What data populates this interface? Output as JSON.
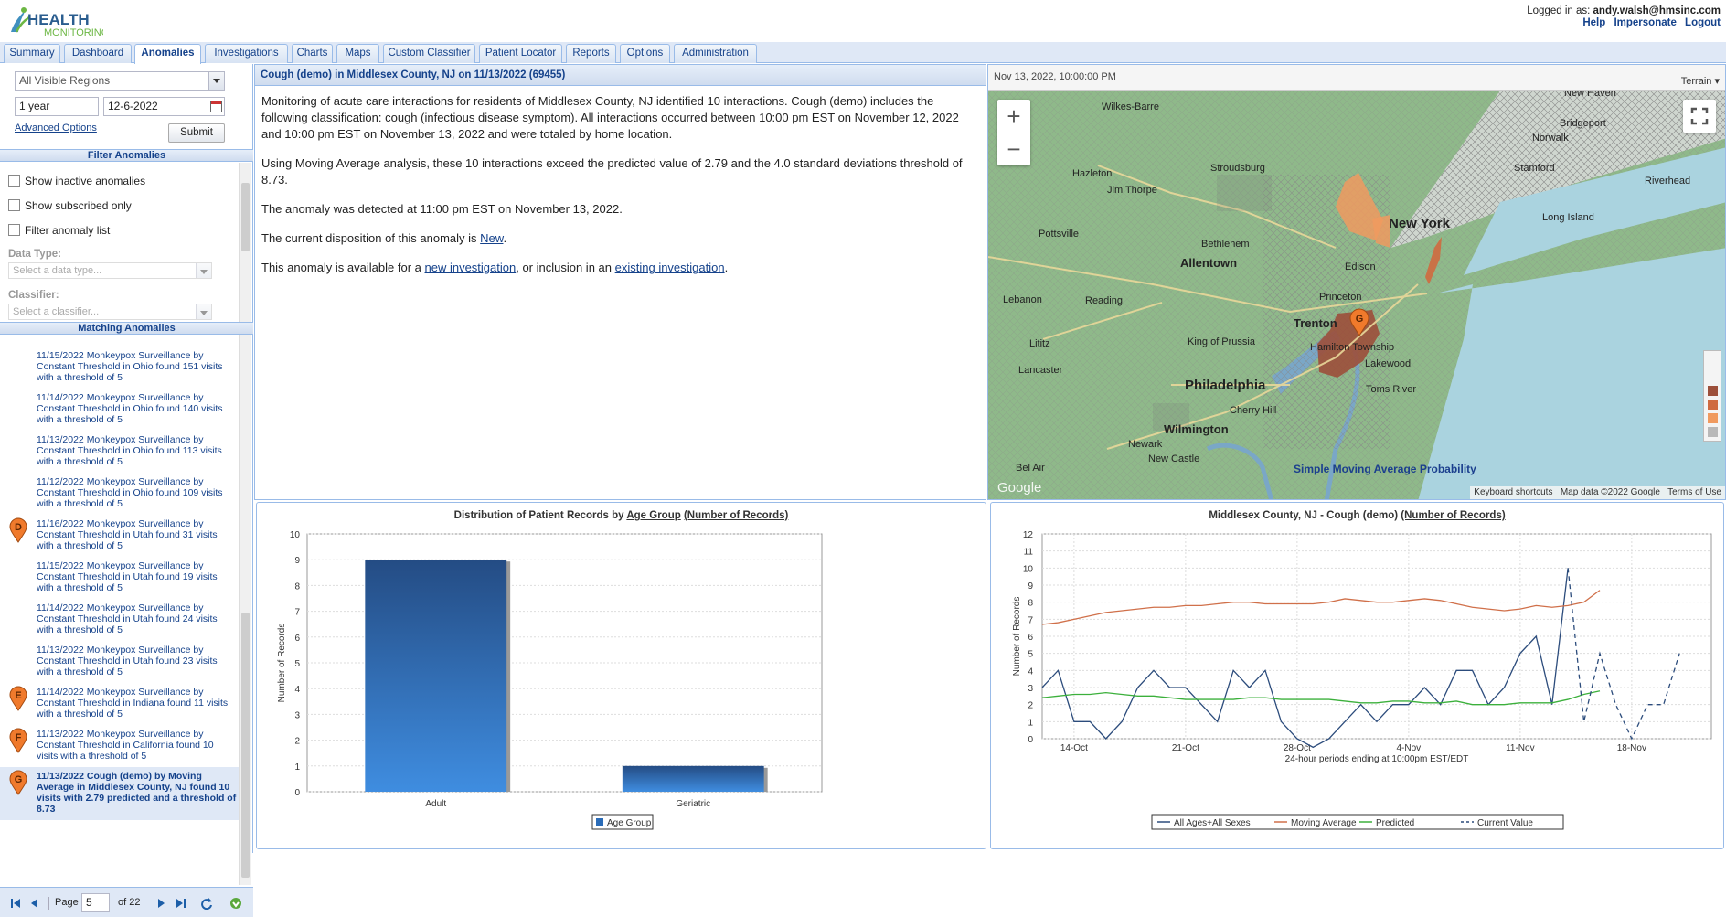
{
  "header": {
    "logo_text": "HEALTH",
    "logo_sub": "MONITORING",
    "logged_in_label": "Logged in as:",
    "user": "andy.walsh@hmsinc.com",
    "links": [
      "Help",
      "Impersonate",
      "Logout"
    ]
  },
  "tabs": [
    "Summary",
    "Dashboard",
    "Anomalies",
    "Investigations",
    "Charts",
    "Maps",
    "Custom Classifier",
    "Patient Locator",
    "Reports",
    "Options",
    "Administration"
  ],
  "active_tab": "Anomalies",
  "left": {
    "region_select": "All Visible Regions",
    "period": "1 year",
    "date": "12-6-2022",
    "advanced_options": "Advanced Options",
    "submit": "Submit",
    "filter_header": "Filter Anomalies",
    "checkboxes": [
      "Show inactive anomalies",
      "Show subscribed only",
      "Filter anomaly list"
    ],
    "data_type_label": "Data Type:",
    "data_type_placeholder": "Select a data type...",
    "classifier_label": "Classifier:",
    "classifier_placeholder": "Select a classifier...",
    "matching_header": "Matching Anomalies",
    "anomalies": [
      {
        "text": "11/15/2022 Monkeypox Surveillance by Constant Threshold in Ohio found 151 visits with a threshold of 5",
        "pin": ""
      },
      {
        "text": "11/14/2022 Monkeypox Surveillance by Constant Threshold in Ohio found 140 visits with a threshold of 5",
        "pin": ""
      },
      {
        "text": "11/13/2022 Monkeypox Surveillance by Constant Threshold in Ohio found 113 visits with a threshold of 5",
        "pin": ""
      },
      {
        "text": "11/12/2022 Monkeypox Surveillance by Constant Threshold in Ohio found 109 visits with a threshold of 5",
        "pin": ""
      },
      {
        "text": "11/16/2022 Monkeypox Surveillance by Constant Threshold in Utah found 31 visits with a threshold of 5",
        "pin": "D"
      },
      {
        "text": "11/15/2022 Monkeypox Surveillance by Constant Threshold in Utah found 19 visits with a threshold of 5",
        "pin": ""
      },
      {
        "text": "11/14/2022 Monkeypox Surveillance by Constant Threshold in Utah found 24 visits with a threshold of 5",
        "pin": ""
      },
      {
        "text": "11/13/2022 Monkeypox Surveillance by Constant Threshold in Utah found 23 visits with a threshold of 5",
        "pin": ""
      },
      {
        "text": "11/14/2022 Monkeypox Surveillance by Constant Threshold in Indiana found 11 visits with a threshold of 5",
        "pin": "E"
      },
      {
        "text": "11/13/2022 Monkeypox Surveillance by Constant Threshold in California found 10 visits with a threshold of 5",
        "pin": "F"
      },
      {
        "text": "11/13/2022 Cough (demo) by Moving Average in Middlesex County, NJ found 10 visits with 2.79 predicted and a threshold of 8.73",
        "pin": "G"
      }
    ],
    "pager": {
      "page_label": "Page",
      "page": "5",
      "of_label": "of 22"
    }
  },
  "center": {
    "title": "Cough (demo) in Middlesex County, NJ on 11/13/2022 (69455)",
    "p1": "Monitoring of acute care interactions for residents of Middlesex County, NJ identified 10 interactions. Cough (demo) includes the following classification: cough (infectious disease symptom). All interactions occurred between 10:00 pm EST on November 12, 2022 and 10:00 pm EST on November 13, 2022 and were totaled by home location.",
    "p2": "Using Moving Average analysis, these 10 interactions exceed the predicted value of 2.79 and the 4.0 standard deviations threshold of 8.73.",
    "p3": "The anomaly was detected at 11:00 pm EST on November 13, 2022.",
    "p4_pre": "The current disposition of this anomaly is ",
    "p4_link": "New",
    "p4_post": ".",
    "p5_pre": "This anomaly is available for a ",
    "p5_link1": "new investigation",
    "p5_mid": ", or inclusion in an ",
    "p5_link2": "existing investigation",
    "p5_post": "."
  },
  "map": {
    "timestamp": "Nov 13, 2022, 10:00:00 PM",
    "map_type": "Terrain",
    "overlay_label": "Simple Moving Average Probability",
    "zoom_in": "+",
    "zoom_out": "−",
    "attribution": [
      "Keyboard shortcuts",
      "Map data ©2022 Google",
      "Terms of Use"
    ],
    "google": "Google",
    "places": [
      "Wilkes-Barre",
      "New Haven",
      "Bridgeport",
      "Norwalk",
      "Stamford",
      "Hazleton",
      "Stroudsburg",
      "Jim Thorpe",
      "New York",
      "Riverhead",
      "Long Island",
      "Pottsville",
      "Bethlehem",
      "Allentown",
      "Edison",
      "Lebanon",
      "Reading",
      "Princeton",
      "Trenton",
      "Lititz",
      "King of Prussia",
      "Hamilton Township",
      "Lakewood",
      "Lancaster",
      "Philadelphia",
      "Toms River",
      "Cherry Hill",
      "Wilmington",
      "Newark",
      "New Castle",
      "Bel Air"
    ],
    "pin": "G",
    "legend_colors": [
      "#9c4f3a",
      "#cf6a3f",
      "#f09a5f",
      "#b8b8b8",
      "#e8e8e8"
    ]
  },
  "bar_chart": {
    "title_pre": "Distribution of Patient Records by ",
    "title_link1": "Age Group",
    "title_link2": "(Number of Records)",
    "legend": "Age Group",
    "chart_data": {
      "type": "bar",
      "categories": [
        "Adult",
        "Geriatric"
      ],
      "values": [
        9,
        1
      ],
      "ylabel": "Number of Records",
      "ylim": [
        0,
        10
      ],
      "yticks": [
        0,
        1,
        2,
        3,
        4,
        5,
        6,
        7,
        8,
        9,
        10
      ],
      "color": "#2b6cb8",
      "grid": true
    }
  },
  "line_chart": {
    "title_pre": "Middlesex County, NJ - Cough (demo) ",
    "title_link": "(Number of Records)",
    "chart_data": {
      "type": "line",
      "xlabel": "24-hour periods ending at 10:00pm EST/EDT",
      "ylabel": "Number of Records",
      "ylim": [
        0,
        12
      ],
      "yticks": [
        0,
        1,
        2,
        3,
        4,
        5,
        6,
        7,
        8,
        9,
        10,
        11,
        12
      ],
      "xticks": [
        "14-Oct",
        "21-Oct",
        "28-Oct",
        "4-Nov",
        "11-Nov",
        "18-Nov"
      ],
      "legend_position": "bottom",
      "series": [
        {
          "name": "All Ages+All Sexes",
          "color": "#2c4c7c",
          "dash": false,
          "values": [
            3,
            4,
            1,
            1,
            0,
            1,
            3,
            4,
            3,
            3,
            2,
            1,
            4,
            3,
            4,
            1,
            0,
            -1,
            0,
            1,
            2,
            1,
            2,
            2,
            3,
            2,
            4,
            4,
            2,
            3,
            5,
            6,
            2,
            10
          ]
        },
        {
          "name": "Moving Average",
          "color": "#d0704a",
          "dash": false,
          "values": [
            6.7,
            6.8,
            7.0,
            7.2,
            7.4,
            7.5,
            7.6,
            7.7,
            7.7,
            7.8,
            7.8,
            7.9,
            8.0,
            8.0,
            7.9,
            7.9,
            7.9,
            7.9,
            8.0,
            8.2,
            8.1,
            8.0,
            8.0,
            8.1,
            8.2,
            8.1,
            7.9,
            7.7,
            7.6,
            7.5,
            7.6,
            7.8,
            7.7,
            7.8,
            8.0,
            8.7
          ]
        },
        {
          "name": "Predicted",
          "color": "#3cb03c",
          "dash": false,
          "values": [
            2.4,
            2.5,
            2.6,
            2.6,
            2.7,
            2.6,
            2.5,
            2.5,
            2.4,
            2.3,
            2.3,
            2.3,
            2.3,
            2.4,
            2.4,
            2.3,
            2.3,
            2.3,
            2.3,
            2.2,
            2.1,
            2.1,
            2.2,
            2.2,
            2.1,
            2.1,
            2.2,
            2.0,
            2.0,
            2.0,
            2.1,
            2.1,
            2.1,
            2.3,
            2.6,
            2.8
          ]
        },
        {
          "name": "Current Value",
          "color": "#2c4c7c",
          "dash": true,
          "values": [
            10,
            1,
            5,
            2,
            0,
            2,
            2,
            5
          ]
        }
      ]
    }
  }
}
